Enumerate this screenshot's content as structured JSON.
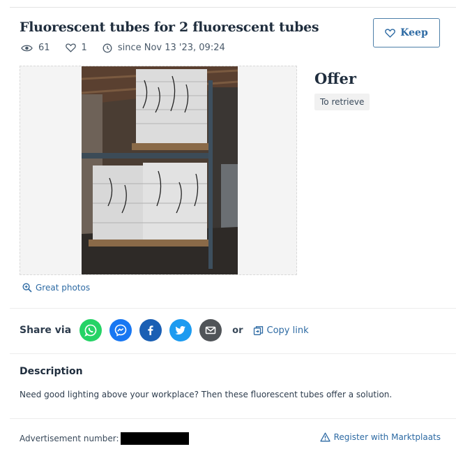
{
  "listing": {
    "title": "Fluorescent tubes for 2 fluorescent tubes",
    "views": "61",
    "favorites": "1",
    "since": "since Nov 13 '23, 09:24",
    "keep_label": "Keep",
    "price_label": "Offer",
    "delivery_badge": "To retrieve",
    "photos_link": "Great photos"
  },
  "share": {
    "label": "Share via",
    "or_label": "or",
    "copy_link_label": "Copy link",
    "icons": [
      "whatsapp-icon",
      "messenger-icon",
      "facebook-icon",
      "twitter-icon",
      "email-icon"
    ],
    "colors": {
      "whatsapp": "#25d366",
      "messenger": "#1877f2",
      "facebook": "#1a5fb4",
      "twitter": "#1d9bf0",
      "email": "#505458"
    }
  },
  "description": {
    "heading": "Description",
    "text": "Need good lighting above your workplace? Then these fluorescent tubes offer a solution."
  },
  "footer": {
    "ad_number_label": "Advertisement number:",
    "register_label": "Register with Marktplaats"
  },
  "colors": {
    "link": "#2d6aa3",
    "text": "#2d3c4d"
  }
}
